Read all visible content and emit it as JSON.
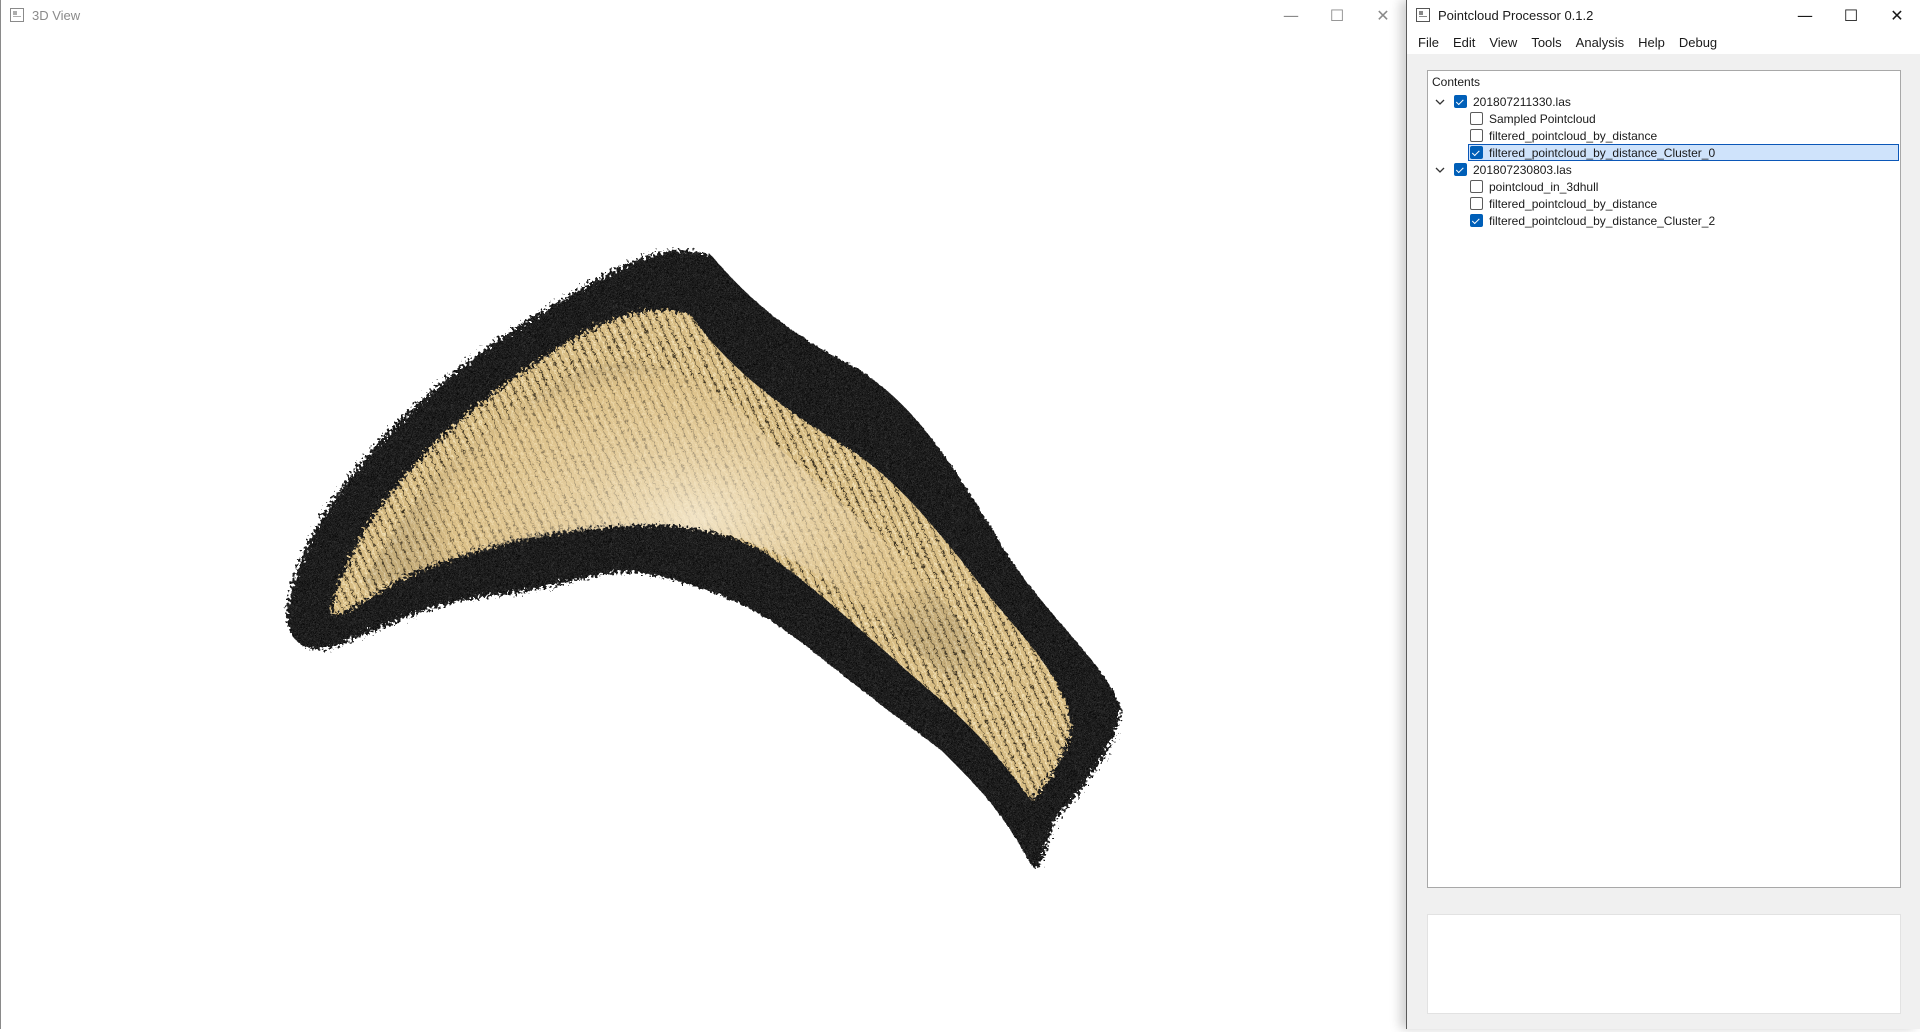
{
  "view_window": {
    "title": "3D View",
    "controls": {
      "minimize": "—",
      "maximize": "☐",
      "close": "✕"
    }
  },
  "processor_window": {
    "title": "Pointcloud Processor 0.1.2",
    "controls": {
      "minimize": "—",
      "maximize": "☐",
      "close": "✕"
    },
    "menu": [
      "File",
      "Edit",
      "View",
      "Tools",
      "Analysis",
      "Help",
      "Debug"
    ],
    "contents_label": "Contents",
    "tree": [
      {
        "label": "201807211330.las",
        "checked": true,
        "expanded": true,
        "children": [
          {
            "label": "Sampled Pointcloud",
            "checked": false,
            "selected": false
          },
          {
            "label": "filtered_pointcloud_by_distance",
            "checked": false,
            "selected": false
          },
          {
            "label": "filtered_pointcloud_by_distance_Cluster_0",
            "checked": true,
            "selected": true
          }
        ]
      },
      {
        "label": "201807230803.las",
        "checked": true,
        "expanded": true,
        "children": [
          {
            "label": "pointcloud_in_3dhull",
            "checked": false,
            "selected": false
          },
          {
            "label": "filtered_pointcloud_by_distance",
            "checked": false,
            "selected": false
          },
          {
            "label": "filtered_pointcloud_by_distance_Cluster_2",
            "checked": true,
            "selected": false
          }
        ]
      }
    ]
  },
  "colors": {
    "checkbox_checked": "#005fb8",
    "selection_fill": "#cfe3fb",
    "selection_border": "#0b57b8",
    "cloud_dark": "#1c1c1c",
    "cloud_light": "#e9d2a0"
  },
  "icons": {
    "view_app_icon": "window-app-icon",
    "proc_app_icon": "window-app-icon",
    "expand": "chevron-down-icon"
  }
}
